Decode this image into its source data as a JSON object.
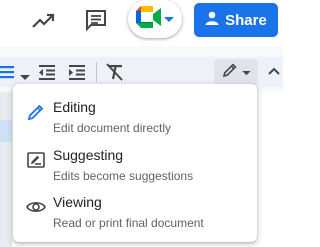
{
  "header": {
    "share_label": "Share",
    "icons": [
      "trending-icon",
      "comment-history-icon",
      "google-meet-icon",
      "person-icon"
    ]
  },
  "toolbar": {
    "icons": [
      "bulleted-list-icon",
      "decrease-indent-icon",
      "increase-indent-icon",
      "clear-formatting-icon",
      "pencil-icon"
    ]
  },
  "mode_menu": {
    "items": [
      {
        "title": "Editing",
        "subtitle": "Edit document directly",
        "icon": "pencil-icon"
      },
      {
        "title": "Suggesting",
        "subtitle": "Edits become suggestions",
        "icon": "suggest-edit-icon"
      },
      {
        "title": "Viewing",
        "subtitle": "Read or print final document",
        "icon": "eye-icon"
      }
    ]
  },
  "colors": {
    "share_blue": "#1a73e8",
    "accent_blue": "#1a73e8",
    "text_primary": "#202124",
    "text_secondary": "#5f6368"
  }
}
